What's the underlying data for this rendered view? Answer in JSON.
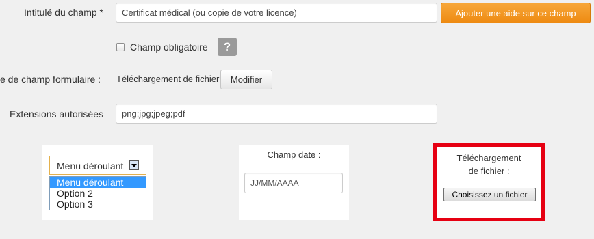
{
  "form": {
    "field_title_label": "Intitulé du champ *",
    "field_title_value": "Certificat médical (ou copie de votre licence)",
    "add_help_button": "Ajouter une aide sur ce champ",
    "required_label": "Champ obligatoire",
    "help_glyph": "?",
    "field_type_label": "e de champ formulaire :",
    "field_type_value": "Téléchargement de fichier",
    "modify_button": "Modifier",
    "extensions_label": "Extensions autorisées",
    "extensions_value": "png;jpg;jpeg;pdf"
  },
  "previews": {
    "dropdown": {
      "selected": "Menu déroulant",
      "options": [
        "Menu déroulant",
        "Option 2",
        "Option 3"
      ]
    },
    "date": {
      "label": "Champ date :",
      "placeholder": "JJ/MM/AAAA"
    },
    "file": {
      "label_line1": "Téléchargement",
      "label_line2": "de fichier :",
      "button": "Choisissez un fichier"
    }
  },
  "colors": {
    "accent_orange": "#f39a1f",
    "highlight_red": "#e60012",
    "selection_blue": "#3399ff"
  }
}
